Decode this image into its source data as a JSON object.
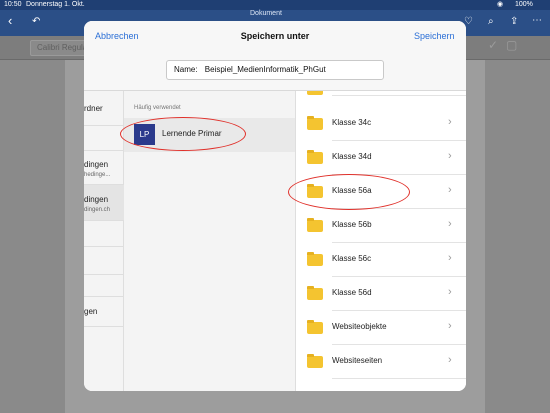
{
  "status_bar": {
    "time": "10:50",
    "date": "Donnerstag 1. Okt.",
    "battery": "100%"
  },
  "app": {
    "window_title": "Dokument",
    "font_name": "Calibri Regular"
  },
  "dialog": {
    "cancel_label": "Abbrechen",
    "title": "Speichern unter",
    "save_label": "Speichern",
    "name_label": "Name:",
    "name_value": "Beispiel_MedienInformatik_PhGut"
  },
  "locations": {
    "items": [
      {
        "label": "rdner"
      },
      {
        "label": "dingen",
        "sublabel": "hedinge..."
      },
      {
        "label": "dingen",
        "sublabel": "dingen.ch"
      },
      {
        "label": "gen"
      }
    ]
  },
  "recent": {
    "section_label": "Häufig verwendet",
    "item": {
      "initials": "LP",
      "label": "Lernende Primar"
    }
  },
  "folders": {
    "items": [
      {
        "label": "Klasse 34c"
      },
      {
        "label": "Klasse 34d"
      },
      {
        "label": "Klasse 56a"
      },
      {
        "label": "Klasse 56b"
      },
      {
        "label": "Klasse 56c"
      },
      {
        "label": "Klasse 56d"
      },
      {
        "label": "Websiteobjekte"
      },
      {
        "label": "Websiteseiten"
      }
    ]
  },
  "colors": {
    "accent": "#2b6fd6",
    "folder": "#f4c430",
    "annotation": "#e0312b"
  }
}
